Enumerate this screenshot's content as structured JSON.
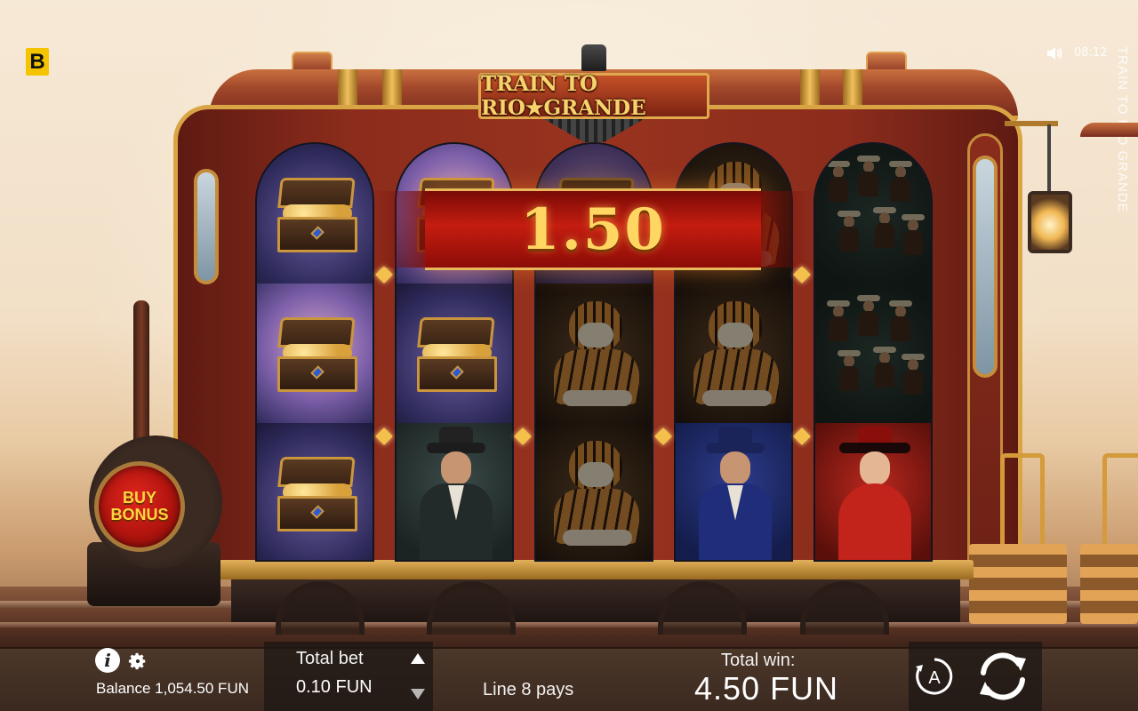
{
  "brand_badge": "B",
  "clock": "08:12",
  "side_title": "TRAIN TO RIO GRANDE",
  "logo_text": "TRAIN TO RIO★GRANDE",
  "buy_bonus": {
    "line1": "BUY",
    "line2": "BONUS"
  },
  "win_banner": "1.50",
  "reels": [
    [
      "treasure-chest",
      "treasure-chest",
      "treasure-chest"
    ],
    [
      "treasure-chest",
      "treasure-chest",
      "sheriff"
    ],
    [
      "treasure-chest",
      "tiger",
      "tiger"
    ],
    [
      "tiger",
      "tiger",
      "gentleman"
    ],
    [
      "cowboys",
      "cowboys",
      "lady"
    ]
  ],
  "bottom_bar": {
    "balance_text": "Balance 1,054.50 FUN",
    "total_bet_label": "Total bet",
    "total_bet_value": "0.10 FUN",
    "line_pays": "Line 8 pays",
    "total_win_label": "Total win:",
    "total_win_value": "4.50 FUN",
    "autoplay_letter": "A"
  },
  "icons": {
    "info": "info-icon",
    "settings": "gear-icon",
    "sound": "speaker-icon",
    "bet_up": "arrow-up-icon",
    "bet_down": "arrow-down-icon",
    "autoplay": "autoplay-icon",
    "spin": "spin-icon"
  },
  "colors": {
    "brand_yellow": "#f5c400",
    "banner_red": "#c41d10",
    "gold": "#e8b85a"
  }
}
